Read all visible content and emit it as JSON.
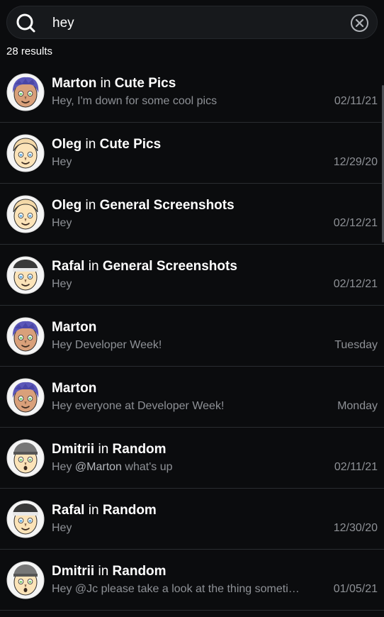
{
  "search": {
    "value": "hey",
    "icon": "search-icon",
    "clear_icon": "close-circle-icon"
  },
  "results": {
    "count_label": "28 results"
  },
  "colors": {
    "background": "#0b0c0e",
    "search_bg": "#17191c",
    "caret": "#3ac9b6",
    "muted_text": "#8e9196"
  },
  "items": [
    {
      "user": "Marton",
      "connector": "in",
      "channel": "Cute Pics",
      "preview": "Hey, I'm down for some cool pics",
      "date": "02/11/21",
      "avatar": "marton"
    },
    {
      "user": "Oleg",
      "connector": "in",
      "channel": "Cute Pics",
      "preview": "Hey",
      "date": "12/29/20",
      "avatar": "oleg"
    },
    {
      "user": "Oleg",
      "connector": "in",
      "channel": "General Screenshots",
      "preview": "Hey",
      "date": "02/12/21",
      "avatar": "oleg"
    },
    {
      "user": "Rafal",
      "connector": "in",
      "channel": "General Screenshots",
      "preview": "Hey",
      "date": "02/12/21",
      "avatar": "rafal"
    },
    {
      "user": "Marton",
      "connector": "",
      "channel": "",
      "preview": "Hey Developer Week!",
      "date": "Tuesday",
      "avatar": "marton"
    },
    {
      "user": "Marton",
      "connector": "",
      "channel": "",
      "preview": "Hey everyone at Developer Week!",
      "date": "Monday",
      "avatar": "marton"
    },
    {
      "user": "Dmitrii",
      "connector": "in",
      "channel": "Random",
      "preview_prefix": "Hey ",
      "preview_mention": "@Marton",
      "preview_suffix": " what's up",
      "date": "02/11/21",
      "avatar": "dmitrii"
    },
    {
      "user": "Rafal",
      "connector": "in",
      "channel": "Random",
      "preview": "Hey",
      "date": "12/30/20",
      "avatar": "rafal"
    },
    {
      "user": "Dmitrii",
      "connector": "in",
      "channel": "Random",
      "preview": "Hey @Jc please take a look at the thing someti…",
      "date": "01/05/21",
      "avatar": "dmitrii"
    }
  ]
}
